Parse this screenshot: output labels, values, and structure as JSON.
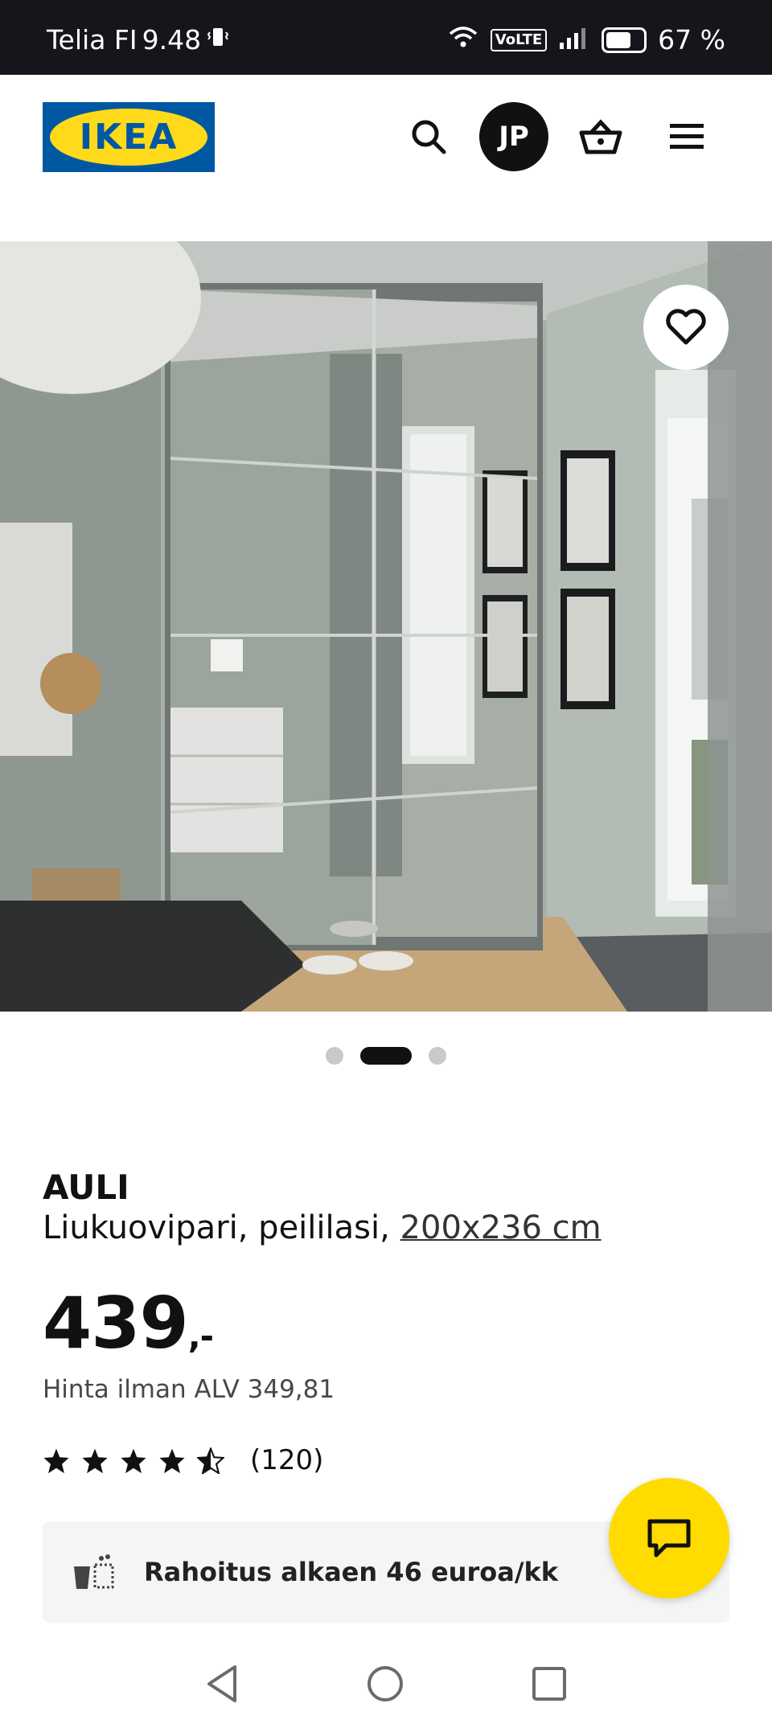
{
  "status_bar": {
    "carrier": "Telia FI",
    "time": "9.48",
    "volte": "VoLTE",
    "battery": "67 %"
  },
  "header": {
    "logo_text": "IKEA",
    "avatar_initials": "JP",
    "icons": [
      "search-icon",
      "basket-icon",
      "menu-icon"
    ]
  },
  "gallery": {
    "dot_count": 3,
    "active_index": 1
  },
  "product": {
    "name": "AULI",
    "description": "Liukuovipari, peililasi,",
    "size": "200x236 cm",
    "price": "439",
    "price_suffix": ",-",
    "vat_text": "Hinta ilman ALV 349,81",
    "rating": 4.5,
    "review_count": "(120)"
  },
  "finance": {
    "text": "Rahoitus alkaen 46 euroa/kk"
  },
  "colors": {
    "ikea_blue": "#0058a3",
    "ikea_yellow": "#ffda1a",
    "chat_yellow": "#ffdb00",
    "status_bar": "#14161b"
  }
}
